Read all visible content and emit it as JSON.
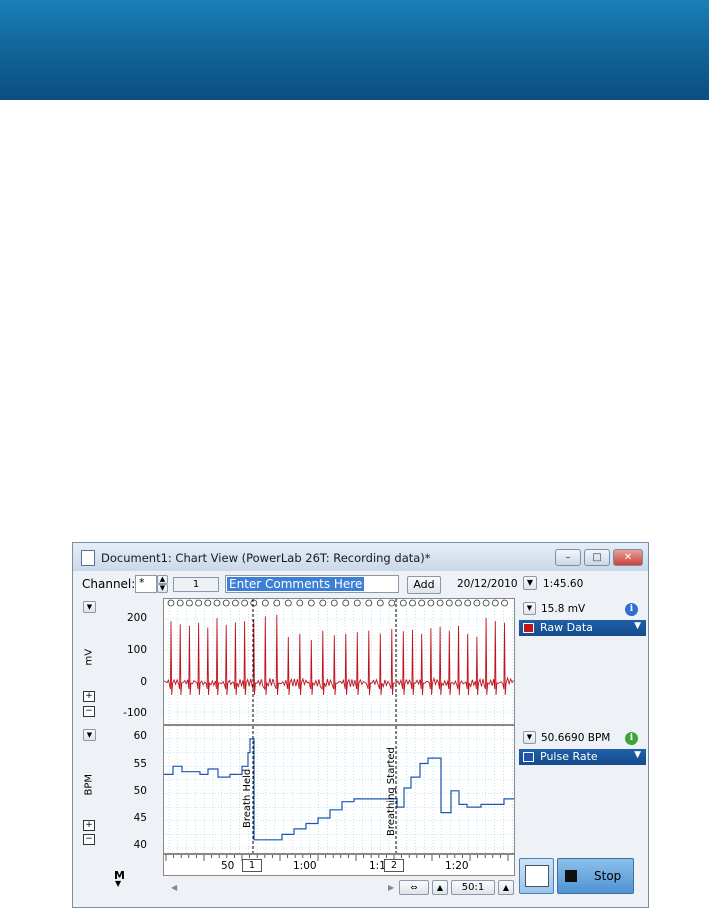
{
  "window": {
    "title": "Document1: Chart View (PowerLab 26T: Recording data)*"
  },
  "toolbar": {
    "channel_label": "Channel:",
    "channel_value": "*",
    "comment_count": "1",
    "comment_placeholder": "Enter Comments Here",
    "add_label": "Add",
    "date": "20/12/2010",
    "time": "1:45.60"
  },
  "channels": [
    {
      "unit": "mV",
      "ticks": [
        "200",
        "100",
        "0",
        "-100"
      ],
      "readout": "15.8 mV",
      "name": "Raw Data",
      "color": "#c0141c"
    },
    {
      "unit": "BPM",
      "ticks": [
        "60",
        "55",
        "50",
        "45",
        "40"
      ],
      "readout": "50.6690 BPM",
      "name": "Pulse Rate",
      "color": "#1f55b0"
    }
  ],
  "comments": [
    {
      "number": "1",
      "text": "Breath Held"
    },
    {
      "number": "2",
      "text": "Breathing Started"
    }
  ],
  "xaxis": {
    "labels": [
      "50",
      "1:00",
      "1:1",
      "1:20"
    ]
  },
  "bottom": {
    "marker_label": "M",
    "zoom": "50:1",
    "stop_label": "Stop"
  },
  "colors": {
    "banner": "#0b4f80",
    "trace_raw": "#c0141c",
    "trace_pulse": "#1f55b0"
  }
}
